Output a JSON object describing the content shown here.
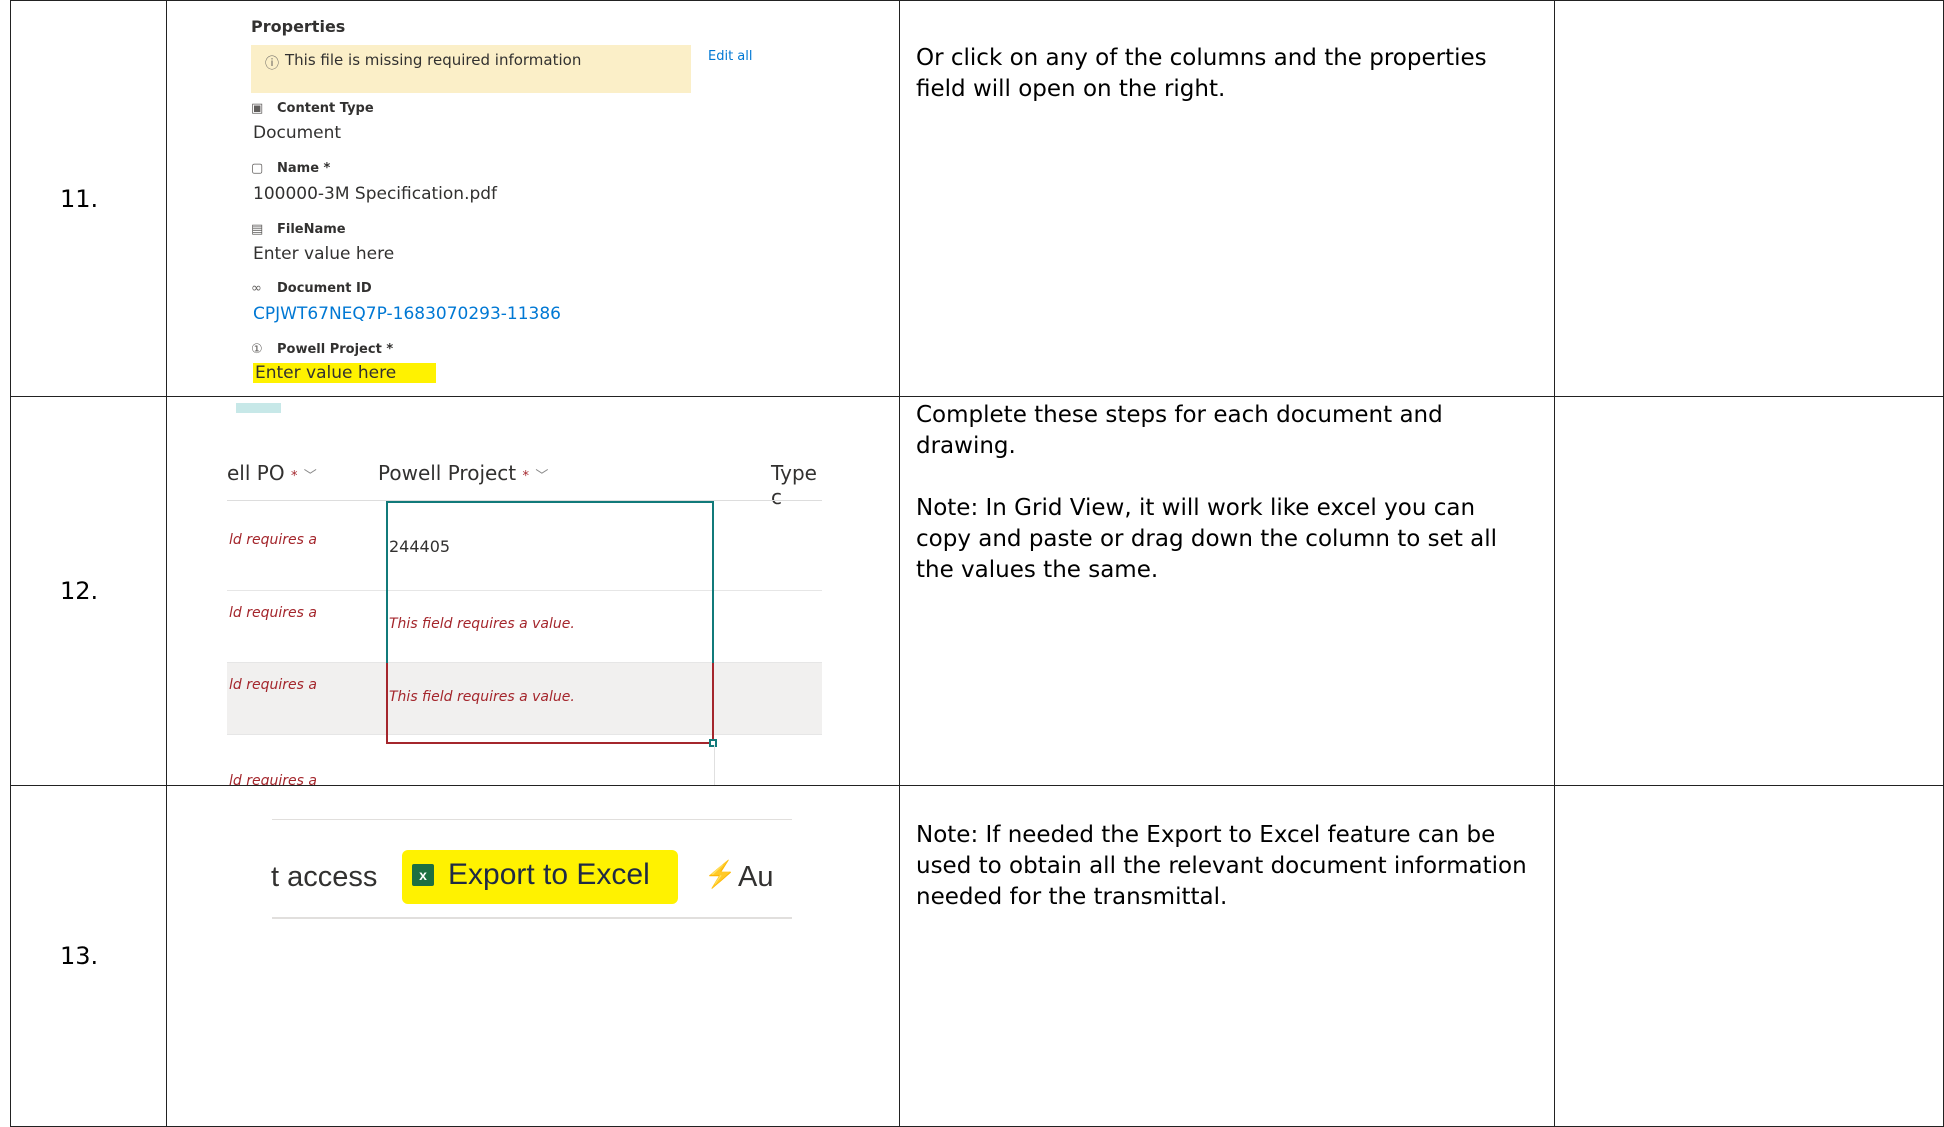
{
  "rows": [
    {
      "number": "11.",
      "description": [
        "Or click on any of the columns and the properties field will open on the right."
      ]
    },
    {
      "number": "12.",
      "description": [
        "Complete these steps for each document and drawing.",
        "Note: In Grid View, it will work like excel you can copy and paste or drag down the column to set all the values the same."
      ]
    },
    {
      "number": "13.",
      "description": [
        "Note: If needed the Export to Excel feature can be used to obtain all the relevant document information needed for the transmittal."
      ]
    }
  ],
  "properties_panel": {
    "title": "Properties",
    "warning": "This file is missing required information",
    "edit_all": "Edit all",
    "content_type_label": "Content Type",
    "content_type_value": "Document",
    "name_label": "Name *",
    "name_value": "100000-3M Specification.pdf",
    "filename_label": "FileName",
    "filename_value": "Enter value here",
    "document_id_label": "Document ID",
    "document_id_value": "CPJWT67NEQ7P-1683070293-11386",
    "powell_project_label": "Powell Project *",
    "powell_project_value": "Enter value here"
  },
  "grid_view": {
    "col_left_header": "ell PO",
    "col_main_header": "Powell Project",
    "col_right_header": "Type c",
    "required_mark": "*",
    "chevron": "﹀",
    "truncated_error": "ld requires a",
    "cell_value": "244405",
    "cell_error": "This field requires a value."
  },
  "ribbon": {
    "access_label": "t access",
    "export_label": "Export to Excel",
    "excel_glyph": "x",
    "automate_label": "Au",
    "automate_icon": "⚡"
  }
}
